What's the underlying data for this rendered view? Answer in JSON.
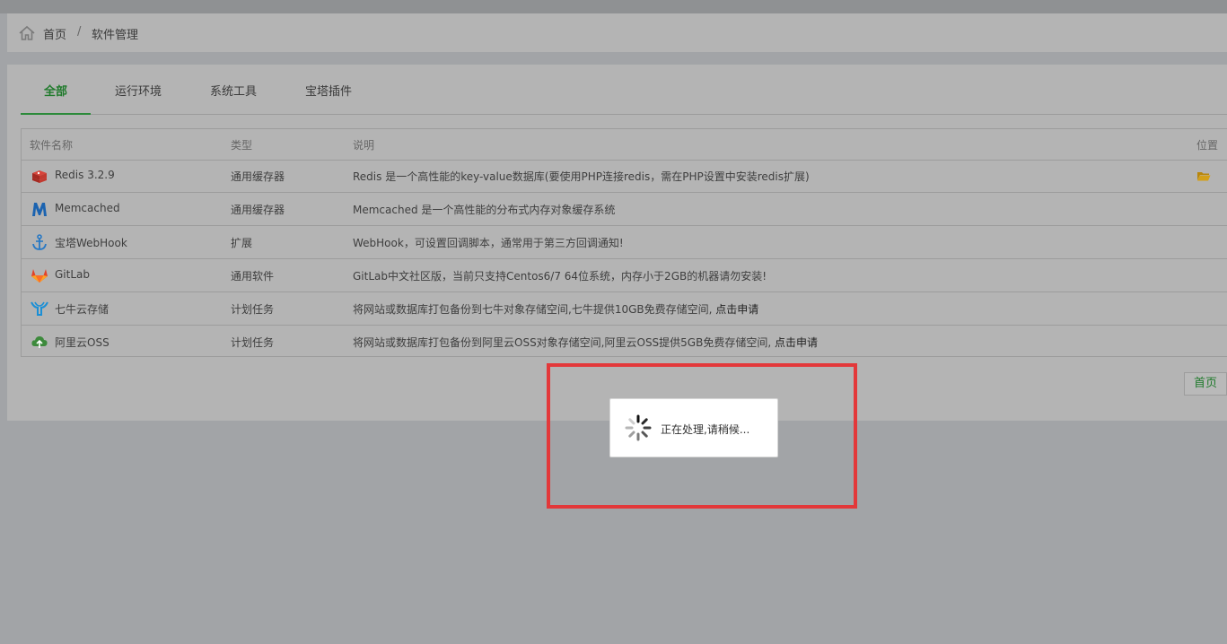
{
  "breadcrumb": {
    "home": "首页",
    "separator": "/",
    "current": "软件管理"
  },
  "tabs": [
    {
      "label": "全部",
      "active": true
    },
    {
      "label": "运行环境",
      "active": false
    },
    {
      "label": "系统工具",
      "active": false
    },
    {
      "label": "宝塔插件",
      "active": false
    }
  ],
  "table": {
    "headers": {
      "name": "软件名称",
      "type": "类型",
      "desc": "说明",
      "location": "位置"
    },
    "rows": [
      {
        "icon": "redis-icon",
        "name": "Redis 3.2.9",
        "type": "通用缓存器",
        "desc": "Redis 是一个高性能的key-value数据库(要使用PHP连接redis，需在PHP设置中安装redis扩展)",
        "link": ""
      },
      {
        "icon": "memcached-icon",
        "name": "Memcached",
        "type": "通用缓存器",
        "desc": "Memcached 是一个高性能的分布式内存对象缓存系统",
        "link": ""
      },
      {
        "icon": "anchor-icon",
        "name": "宝塔WebHook",
        "type": "扩展",
        "desc": "WebHook，可设置回调脚本，通常用于第三方回调通知!",
        "link": ""
      },
      {
        "icon": "gitlab-icon",
        "name": "GitLab",
        "type": "通用软件",
        "desc": "GitLab中文社区版，当前只支持Centos6/7 64位系统，内存小于2GB的机器请勿安装!",
        "link": ""
      },
      {
        "icon": "qiniu-icon",
        "name": "七牛云存储",
        "type": "计划任务",
        "desc": "将网站或数据库打包备份到七牛对象存储空间,七牛提供10GB免费存储空间, ",
        "link": "点击申请"
      },
      {
        "icon": "aliyun-oss-icon",
        "name": "阿里云OSS",
        "type": "计划任务",
        "desc": "将网站或数据库打包备份到阿里云OSS对象存储空间,阿里云OSS提供5GB免费存储空间, ",
        "link": "点击申请"
      }
    ]
  },
  "pagination": {
    "first": "首页"
  },
  "loading": {
    "message": "正在处理,请稍候..."
  },
  "colors": {
    "accent": "#2c8a3a",
    "highlight": "#e3383a"
  }
}
